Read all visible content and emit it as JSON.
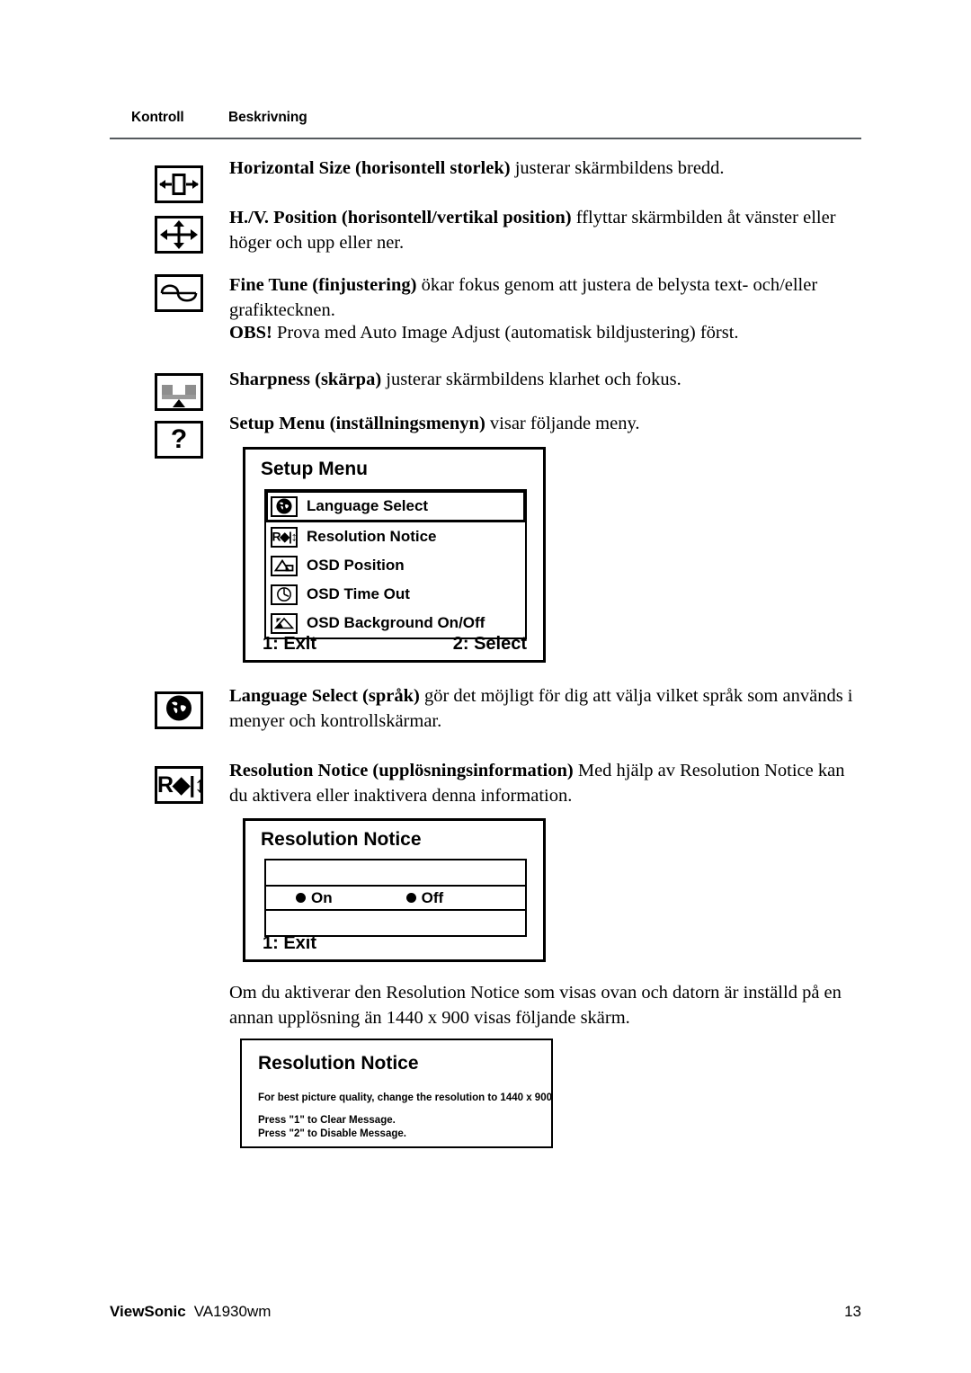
{
  "header": {
    "col_control": "Kontroll",
    "col_description": "Beskrivning"
  },
  "entries": [
    {
      "icon": "horizontal-size-icon",
      "term": "Horizontal Size (horisontell storlek)",
      "text": " justerar skärmbildens bredd."
    },
    {
      "icon": "hv-position-icon",
      "term": "H./V. Position (horisontell/vertikal position)",
      "text": " fflyttar skärmbilden åt vänster eller höger och upp eller ner."
    },
    {
      "icon": "fine-tune-icon",
      "term": "Fine Tune (finjustering)",
      "text": " ökar fokus genom att justera de belysta text- och/eller grafiktecknen.",
      "term2": "OBS!",
      "text2": " Prova med Auto Image Adjust (automatisk bildjustering) först."
    },
    {
      "icon": "sharpness-icon",
      "term": "Sharpness (skärpa)",
      "text": " justerar skärmbildens klarhet och fokus."
    },
    {
      "icon": "setup-menu-icon",
      "term": "Setup Menu (inställningsmenyn)",
      "text": " visar följande meny."
    },
    {
      "icon": "language-select-icon",
      "term": "Language Select (språk)",
      "text": " gör det möjligt för dig att välja vilket språk som används i menyer och kontrollskärmar."
    },
    {
      "icon": "resolution-notice-icon",
      "term": "Resolution Notice (upplösningsinformation)",
      "text": " Med hjälp av Resolution Notice kan du aktivera eller inaktivera denna information."
    }
  ],
  "setup_menu_osd": {
    "title": "Setup Menu",
    "items": [
      {
        "icon": "globe-icon",
        "label": "Language Select",
        "highlighted": true
      },
      {
        "icon": "resolution-notice-icon",
        "label": "Resolution Notice",
        "highlighted": false
      },
      {
        "icon": "osd-position-icon",
        "label": "OSD Position",
        "highlighted": false
      },
      {
        "icon": "clock-icon",
        "label": "OSD Time Out",
        "highlighted": false
      },
      {
        "icon": "osd-background-icon",
        "label": "OSD Background On/Off",
        "highlighted": false
      }
    ],
    "exit_label": "1: Exit",
    "select_label": "2: Select"
  },
  "resolution_notice_osd": {
    "title": "Resolution Notice",
    "option_on": "On",
    "option_off": "Off",
    "exit_label": "1: Exit"
  },
  "after_box_paragraph": "Om du aktiverar den Resolution Notice som visas ovan och datorn är inställd på en annan upplösning än 1440 x 900 visas följande skärm.",
  "resolution_message_osd": {
    "title": "Resolution Notice",
    "line1": "For best picture quality, change the resolution to 1440 x 900",
    "line2": "Press \"1\" to Clear Message.",
    "line3": "Press \"2\" to Disable Message."
  },
  "footer": {
    "brand": "ViewSonic",
    "model": "VA1930wm",
    "page_number": "13"
  },
  "icon_glyphs": {
    "question_mark": "?",
    "resolution_gutter": "R◆|↕",
    "resolution_menu": "R◆|↕"
  }
}
